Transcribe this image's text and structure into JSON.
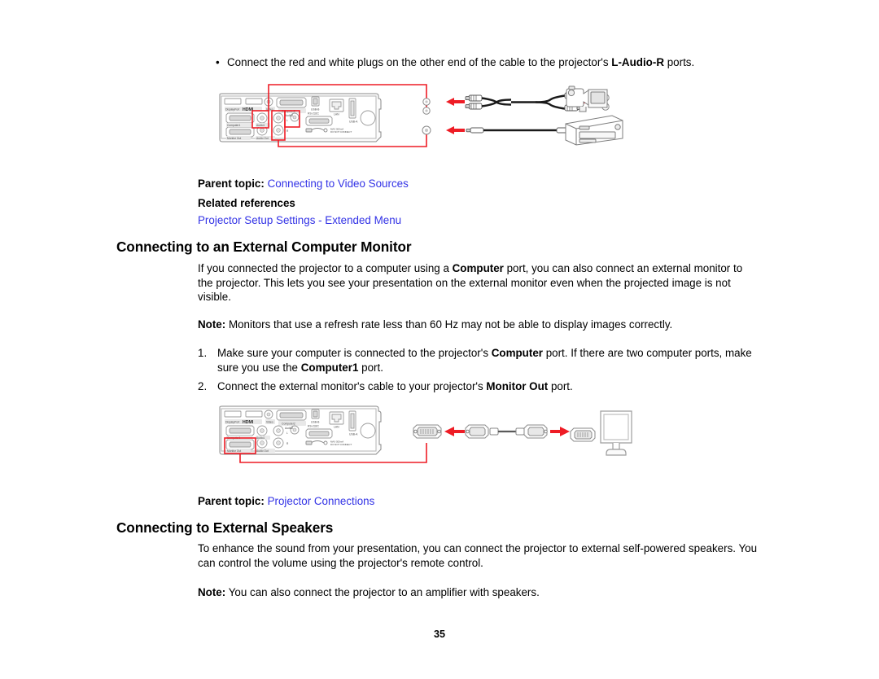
{
  "document": {
    "page_number": "35",
    "link_color": "#3232e6",
    "highlight_color": "#ee1c25"
  },
  "bullet": {
    "marker": "•",
    "text_before": "Connect the red and white plugs on the other end of the cable to the projector's ",
    "bold": "L-Audio-R",
    "text_after": " ports."
  },
  "figure_audio": {
    "title": "projector-to-video-source-audio-cable-diagram",
    "port_labels": [
      "DisplayPort",
      "HDMI",
      "Video",
      "Computer2",
      "USB-B",
      "Computer1",
      "Audio1",
      "Audio2",
      "RS-232C",
      "LAN",
      "USB-A",
      "Monitor Out",
      "Audio Out",
      "L/R"
    ],
    "device_labels": [
      "camcorder",
      "dvd-vcr-player"
    ]
  },
  "section1": {
    "parent_topic_label": "Parent topic:",
    "parent_topic_link": "Connecting to Video Sources",
    "related_references_label": "Related references",
    "related_reference_link": "Projector Setup Settings - Extended Menu"
  },
  "section2": {
    "heading": "Connecting to an External Computer Monitor",
    "intro_part1": "If you connected the projector to a computer using a ",
    "intro_bold1": "Computer",
    "intro_part2": " port, you can also connect an external monitor to the projector. This lets you see your presentation on the external monitor even when the projected image is not visible.",
    "note_label": "Note:",
    "note_text": " Monitors that use a refresh rate less than 60 Hz may not be able to display images correctly.",
    "steps": [
      {
        "number": "1.",
        "part1": "Make sure your computer is connected to the projector's ",
        "bold1": "Computer",
        "part2": " port. If there are two computer ports, make sure you use the ",
        "bold2": "Computer1",
        "part3": " port."
      },
      {
        "number": "2.",
        "part1": "Connect the external monitor's cable to your projector's ",
        "bold1": "Monitor Out",
        "part2": " port.",
        "bold2": "",
        "part3": ""
      }
    ],
    "parent_topic_label": "Parent topic:",
    "parent_topic_link": "Projector Connections"
  },
  "figure_monitor": {
    "title": "projector-to-external-monitor-vga-cable-diagram",
    "port_labels": [
      "DisplayPort",
      "HDMI",
      "Video",
      "Computer2",
      "USB-B",
      "Computer1",
      "Audio1",
      "Audio2",
      "RS-232C",
      "LAN",
      "USB-A",
      "Monitor Out",
      "Audio Out",
      "L/R"
    ],
    "device_labels": [
      "external-monitor"
    ]
  },
  "section3": {
    "heading": "Connecting to External Speakers",
    "intro": "To enhance the sound from your presentation, you can connect the projector to external self-powered speakers. You can control the volume using the projector's remote control.",
    "note_label": "Note:",
    "note_text": " You can also connect the projector to an amplifier with speakers."
  }
}
